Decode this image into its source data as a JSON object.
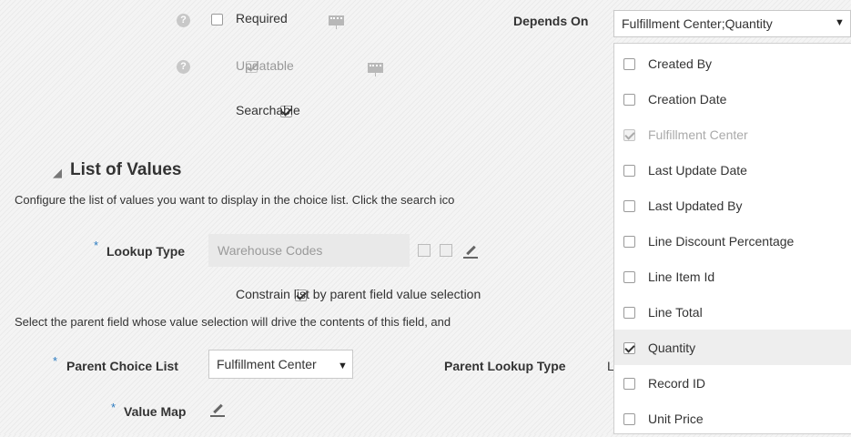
{
  "top_rows": [
    {
      "label": "Required",
      "checked": false,
      "disabled": false
    },
    {
      "label": "Updatable",
      "checked": true,
      "disabled": true
    },
    {
      "label": "Searchable",
      "checked": true,
      "disabled": false
    }
  ],
  "depends_on": {
    "label": "Depends On",
    "value": "Fulfillment Center;Quantity",
    "options": [
      {
        "label": "Created By",
        "checked": false,
        "disabled": false,
        "highlighted": false
      },
      {
        "label": "Creation Date",
        "checked": false,
        "disabled": false,
        "highlighted": false
      },
      {
        "label": "Fulfillment Center",
        "checked": true,
        "disabled": true,
        "highlighted": false
      },
      {
        "label": "Last Update Date",
        "checked": false,
        "disabled": false,
        "highlighted": false
      },
      {
        "label": "Last Updated By",
        "checked": false,
        "disabled": false,
        "highlighted": false
      },
      {
        "label": "Line Discount Percentage",
        "checked": false,
        "disabled": false,
        "highlighted": false
      },
      {
        "label": "Line Item Id",
        "checked": false,
        "disabled": false,
        "highlighted": false
      },
      {
        "label": "Line Total",
        "checked": false,
        "disabled": false,
        "highlighted": false
      },
      {
        "label": "Quantity",
        "checked": true,
        "disabled": false,
        "highlighted": true
      },
      {
        "label": "Record ID",
        "checked": false,
        "disabled": false,
        "highlighted": false
      },
      {
        "label": "Unit Price",
        "checked": false,
        "disabled": false,
        "highlighted": false
      }
    ]
  },
  "section": {
    "title": "List of Values",
    "description": "Configure the list of values you want to display in the choice list. Click the search ico",
    "parent_description": "Select the parent field whose value selection will drive the contents of this field, and"
  },
  "lookup_type": {
    "required_marker": "*",
    "label": "Lookup Type",
    "value": "Warehouse Codes"
  },
  "constrain": {
    "label": "Constrain list by parent field value selection",
    "checked": true
  },
  "parent_choice_list": {
    "required_marker": "*",
    "label": "Parent Choice List",
    "value": "Fulfillment Center"
  },
  "parent_lookup_type": {
    "label": "Parent Lookup Type",
    "value_partial": "L"
  },
  "value_map": {
    "required_marker": "*",
    "label": "Value Map"
  },
  "icons": {
    "help": "?",
    "caret": "▼",
    "collapse": "◢"
  }
}
